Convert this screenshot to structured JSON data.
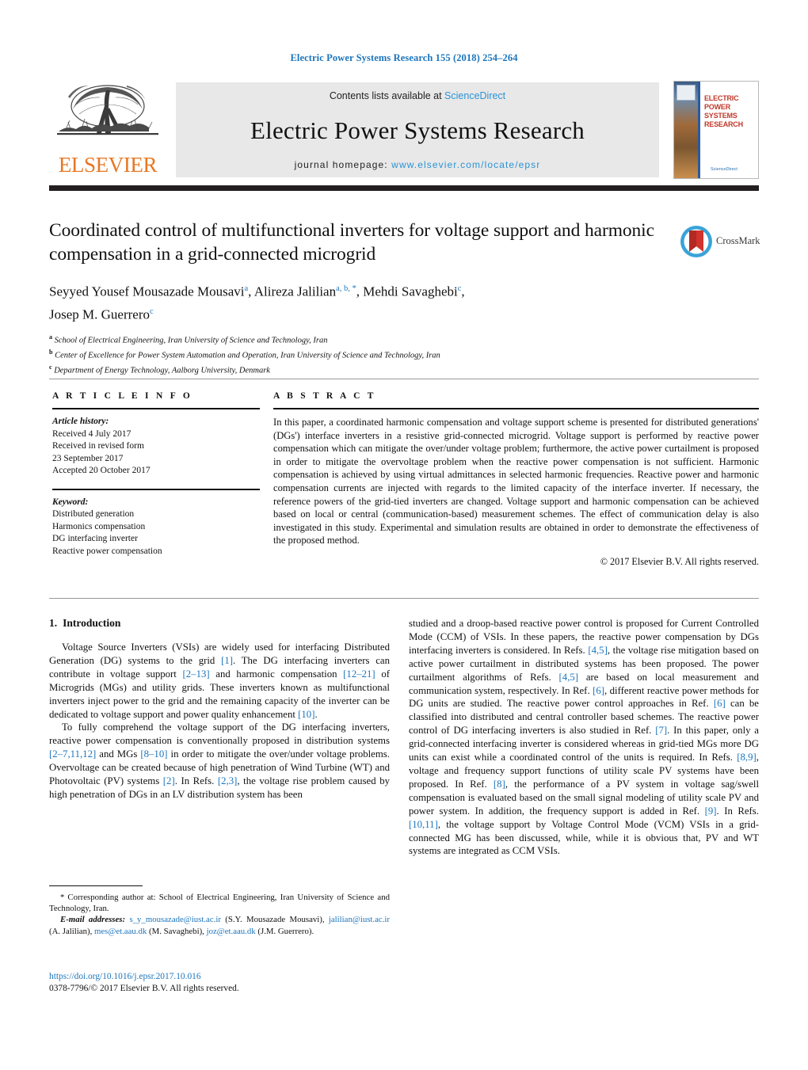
{
  "running_head": "Electric Power Systems Research 155 (2018) 254–264",
  "masthead": {
    "publisher": "ELSEVIER",
    "contents_prefix": "Contents lists available at ",
    "contents_link": "ScienceDirect",
    "journal_title": "Electric Power Systems Research",
    "homepage_prefix": "journal homepage: ",
    "homepage_url": "www.elsevier.com/locate/epsr",
    "cover_title": "ELECTRIC POWER SYSTEMS RESEARCH",
    "cover_footer": "ScienceDirect"
  },
  "article": {
    "title": "Coordinated control of multifunctional inverters for voltage support and harmonic compensation in a grid-connected microgrid",
    "authors_line1_name1": "Seyyed Yousef Mousazade Mousavi",
    "authors_line1_mark1": "a",
    "authors_sep1": ", ",
    "authors_line1_name2": "Alireza Jalilian",
    "authors_line1_mark2": "a, b, *",
    "authors_sep2": ", ",
    "authors_line1_name3": "Mehdi Savaghebi",
    "authors_line1_mark3": "c",
    "authors_sep3": ",",
    "authors_line2_name": "Josep M. Guerrero",
    "authors_line2_mark": "c",
    "affiliations": [
      {
        "mark": "a",
        "text": "School of Electrical Engineering, Iran University of Science and Technology, Iran"
      },
      {
        "mark": "b",
        "text": "Center of Excellence for Power System Automation and Operation, Iran University of Science and Technology, Iran"
      },
      {
        "mark": "c",
        "text": "Department of Energy Technology, Aalborg University, Denmark"
      }
    ],
    "crossmark_label": "CrossMark"
  },
  "article_info": {
    "heading": "A R T I C L E   I N F O",
    "history_label": "Article history:",
    "history": [
      "Received 4 July 2017",
      "Received in revised form",
      "23 September 2017",
      "Accepted 20 October 2017"
    ],
    "keywords_label": "Keyword:",
    "keywords": [
      "Distributed generation",
      "Harmonics compensation",
      "DG interfacing inverter",
      "Reactive power compensation"
    ]
  },
  "abstract": {
    "heading": "A B S T R A C T",
    "body": "In this paper, a coordinated harmonic compensation and voltage support scheme is presented for distributed generations' (DGs') interface inverters in a resistive grid-connected microgrid. Voltage support is performed by reactive power compensation which can mitigate the over/under voltage problem; furthermore, the active power curtailment is proposed in order to mitigate the overvoltage problem when the reactive power compensation is not sufficient. Harmonic compensation is achieved by using virtual admittances in selected harmonic frequencies. Reactive power and harmonic compensation currents are injected with regards to the limited capacity of the interface inverter. If necessary, the reference powers of the grid-tied inverters are changed. Voltage support and harmonic compensation can be achieved based on local or central (communication-based) measurement schemes. The effect of communication delay is also investigated in this study. Experimental and simulation results are obtained in order to demonstrate the effectiveness of the proposed method.",
    "copyright": "© 2017 Elsevier B.V. All rights reserved."
  },
  "introduction": {
    "number": "1.",
    "title": "Introduction",
    "left_paragraph_1_parts": [
      {
        "t": "Voltage Source Inverters (VSIs) are widely used for interfacing Distributed Generation (DG) systems to the grid ",
        "ref": false
      },
      {
        "t": "[1]",
        "ref": true
      },
      {
        "t": ". The DG interfacing inverters can contribute in voltage support ",
        "ref": false
      },
      {
        "t": "[2–13]",
        "ref": true
      },
      {
        "t": " and harmonic compensation ",
        "ref": false
      },
      {
        "t": "[12–21]",
        "ref": true
      },
      {
        "t": " of Microgrids (MGs) and utility grids. These inverters known as multifunctional inverters inject power to the grid and the remaining capacity of the inverter can be dedicated to voltage support and power quality enhancement ",
        "ref": false
      },
      {
        "t": "[10]",
        "ref": true
      },
      {
        "t": ".",
        "ref": false
      }
    ],
    "left_paragraph_2_parts": [
      {
        "t": "To fully comprehend the voltage support of the DG interfacing inverters, reactive power compensation is conventionally proposed in distribution systems ",
        "ref": false
      },
      {
        "t": "[2–7,11,12]",
        "ref": true
      },
      {
        "t": " and MGs ",
        "ref": false
      },
      {
        "t": "[8–10]",
        "ref": true
      },
      {
        "t": " in order to mitigate the over/under voltage problems. Overvoltage can be created because of high penetration of Wind Turbine (WT) and Photovoltaic (PV) systems ",
        "ref": false
      },
      {
        "t": "[2]",
        "ref": true
      },
      {
        "t": ". In Refs. ",
        "ref": false
      },
      {
        "t": "[2,3]",
        "ref": true
      },
      {
        "t": ", the voltage rise problem caused by high penetration of DGs in an LV distribution system has been",
        "ref": false
      }
    ],
    "right_paragraph_parts": [
      {
        "t": "studied and a droop-based reactive power control is proposed for Current Controlled Mode (CCM) of VSIs. In these papers, the reactive power compensation by DGs interfacing inverters is considered. In Refs. ",
        "ref": false
      },
      {
        "t": "[4,5]",
        "ref": true
      },
      {
        "t": ", the voltage rise mitigation based on active power curtailment in distributed systems has been proposed. The power curtailment algorithms of Refs. ",
        "ref": false
      },
      {
        "t": "[4,5]",
        "ref": true
      },
      {
        "t": " are based on local measurement and communication system, respectively. In Ref. ",
        "ref": false
      },
      {
        "t": "[6]",
        "ref": true
      },
      {
        "t": ", different reactive power methods for DG units are studied. The reactive power control approaches in Ref. ",
        "ref": false
      },
      {
        "t": "[6]",
        "ref": true
      },
      {
        "t": " can be classified into distributed and central controller based schemes. The reactive power control of DG interfacing inverters is also studied in Ref. ",
        "ref": false
      },
      {
        "t": "[7]",
        "ref": true
      },
      {
        "t": ". In this paper, only a grid-connected interfacing inverter is considered whereas in grid-tied MGs more DG units can exist while a coordinated control of the units is required. In Refs. ",
        "ref": false
      },
      {
        "t": "[8,9]",
        "ref": true
      },
      {
        "t": ", voltage and frequency support functions of utility scale PV systems have been proposed. In Ref. ",
        "ref": false
      },
      {
        "t": "[8]",
        "ref": true
      },
      {
        "t": ", the performance of a PV system in voltage sag/swell compensation is evaluated based on the small signal modeling of utility scale PV and power system. In addition, the frequency support is added in Ref. ",
        "ref": false
      },
      {
        "t": "[9]",
        "ref": true
      },
      {
        "t": ". In Refs. ",
        "ref": false
      },
      {
        "t": "[10,11]",
        "ref": true
      },
      {
        "t": ", the voltage support by Voltage Control Mode (VCM) VSIs in a grid-connected MG has been discussed, while, while it is obvious that, PV and WT systems are integrated as CCM VSIs.",
        "ref": false
      }
    ]
  },
  "footnotes": {
    "corresponding_star": "*",
    "corresponding_text": "Corresponding author at: School of Electrical Engineering, Iran University of Science and Technology, Iran.",
    "email_label": "E-mail addresses:",
    "emails": [
      {
        "address": "s_y_mousazade@iust.ac.ir",
        "person": "(S.Y. Mousazade Mousavi),"
      },
      {
        "address": "jalilian@iust.ac.ir",
        "person": "(A. Jalilian),"
      },
      {
        "address": "mes@et.aau.dk",
        "person": "(M. Savaghebi),"
      },
      {
        "address": "joz@et.aau.dk",
        "person": "(J.M. Guerrero)."
      }
    ],
    "doi": "https://doi.org/10.1016/j.epsr.2017.10.016",
    "issn_line": "0378-7796/© 2017 Elsevier B.V. All rights reserved."
  },
  "colors": {
    "link_blue": "#1c75bc",
    "sciencedirect_blue": "#2a93d5",
    "elsevier_orange": "#e87722",
    "rule_black": "#231f20",
    "cover_red": "#c0392b"
  }
}
